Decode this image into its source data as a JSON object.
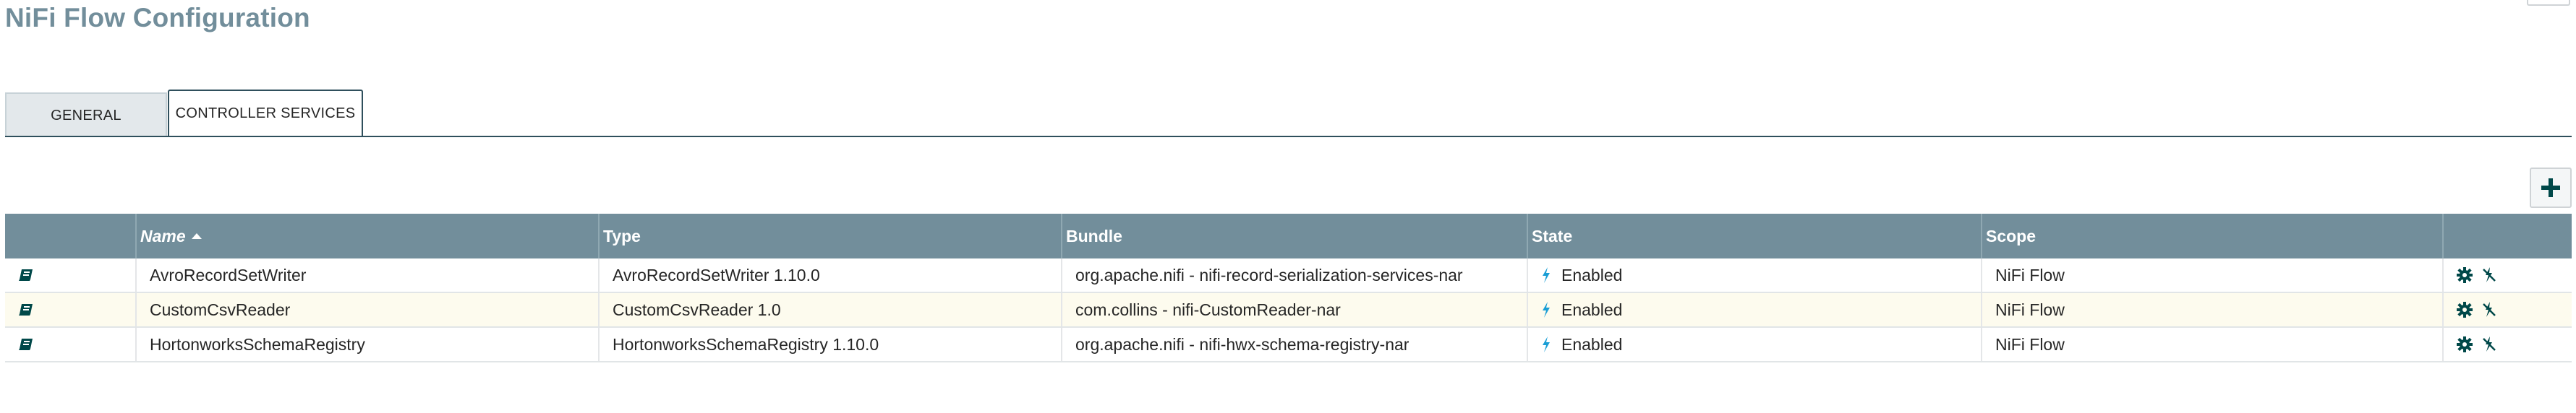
{
  "page": {
    "title": "NiFi Flow Configuration"
  },
  "tabs": [
    {
      "label": "GENERAL",
      "selected": false
    },
    {
      "label": "CONTROLLER SERVICES",
      "selected": true
    }
  ],
  "toolbar": {
    "add_icon": "plus-icon"
  },
  "table": {
    "columns": {
      "name": "Name",
      "type": "Type",
      "bundle": "Bundle",
      "state": "State",
      "scope": "Scope"
    },
    "sort": {
      "column": "name",
      "direction": "ascending"
    },
    "rows": [
      {
        "name": "AvroRecordSetWriter",
        "type": "AvroRecordSetWriter 1.10.0",
        "bundle": "org.apache.nifi - nifi-record-serialization-services-nar",
        "state": "Enabled",
        "scope": "NiFi Flow"
      },
      {
        "name": "CustomCsvReader",
        "type": "CustomCsvReader 1.0",
        "bundle": "com.collins - nifi-CustomReader-nar",
        "state": "Enabled",
        "scope": "NiFi Flow"
      },
      {
        "name": "HortonworksSchemaRegistry",
        "type": "HortonworksSchemaRegistry 1.10.0",
        "bundle": "org.apache.nifi - nifi-hwx-schema-registry-nar",
        "state": "Enabled",
        "scope": "NiFi Flow"
      }
    ],
    "icons": {
      "row": "book-icon",
      "state": "lightning-bolt-icon",
      "configure": "gear-icon",
      "disable": "disable-bolt-icon"
    }
  },
  "colors": {
    "header_bg": "#728e9b",
    "accent": "#004849",
    "alt_row": "#fdfbee",
    "enabled": "#1a9ed5",
    "title": "#728e9b"
  }
}
